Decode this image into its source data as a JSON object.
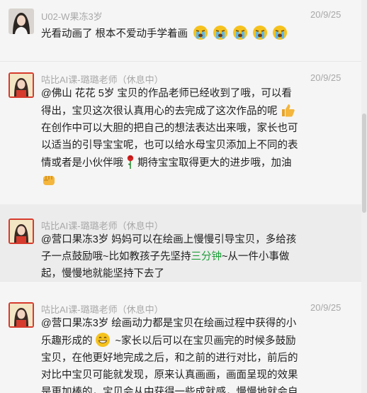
{
  "messages": [
    {
      "sender": "U02-W果冻3岁",
      "status": "",
      "date": "20/9/25",
      "text_parts": [
        "光看动画了 根本不爱动手学着画"
      ],
      "emojis": [
        "crying-face",
        "crying-face",
        "crying-face",
        "crying-face",
        "crying-face"
      ]
    },
    {
      "sender": "咕比AI课-璐璐老师",
      "status": "（休息中）",
      "date": "20/9/25",
      "lines": [
        "@佛山 花花  5岁 宝贝的作品老师已经收到了哦，可以看",
        "得出，宝贝这次很认真用心的去完成了这次作品的呢",
        "在创作中可以大胆的把自己的想法表达出来哦，家长也可",
        "以适当的引导宝宝呢，也可以给水母宝贝添加上不同的表",
        "情或者是小伙伴哦",
        "期待宝宝取得更大的进步哦，加油"
      ],
      "emojis": [
        "thumbs-up",
        "rose",
        "fist"
      ]
    },
    {
      "sender": "咕比AI课-璐璐老师",
      "status": "（休息中）",
      "date": "20/9/25",
      "lines_a": "@营口果冻3岁  妈妈可以在绘画上慢慢引导宝贝，多给孩",
      "lines_b": "子一点鼓励哦~比如教孩子先坚持",
      "highlight": "三分钟",
      "lines_c": "~从一件小事做",
      "lines_d": "起，慢慢地就能坚持下去了"
    },
    {
      "sender": "咕比AI课-璐璐老师",
      "status": "（休息中）",
      "date": "20/9/25",
      "lines": [
        "@营口果冻3岁  绘画动力都是宝贝在绘画过程中获得的小",
        "乐趣形成的",
        " ~家长以后可以在宝贝画完的时候多鼓励",
        "宝贝，在他更好地完成之后，和之前的进行对比，前后的",
        "对比中宝贝可能就发现，原来认真画画，画面呈现的效果",
        "是更加棒的，宝贝会从中获得一些成就感，慢慢地就会自"
      ],
      "emojis": [
        "grinning-face"
      ]
    }
  ]
}
